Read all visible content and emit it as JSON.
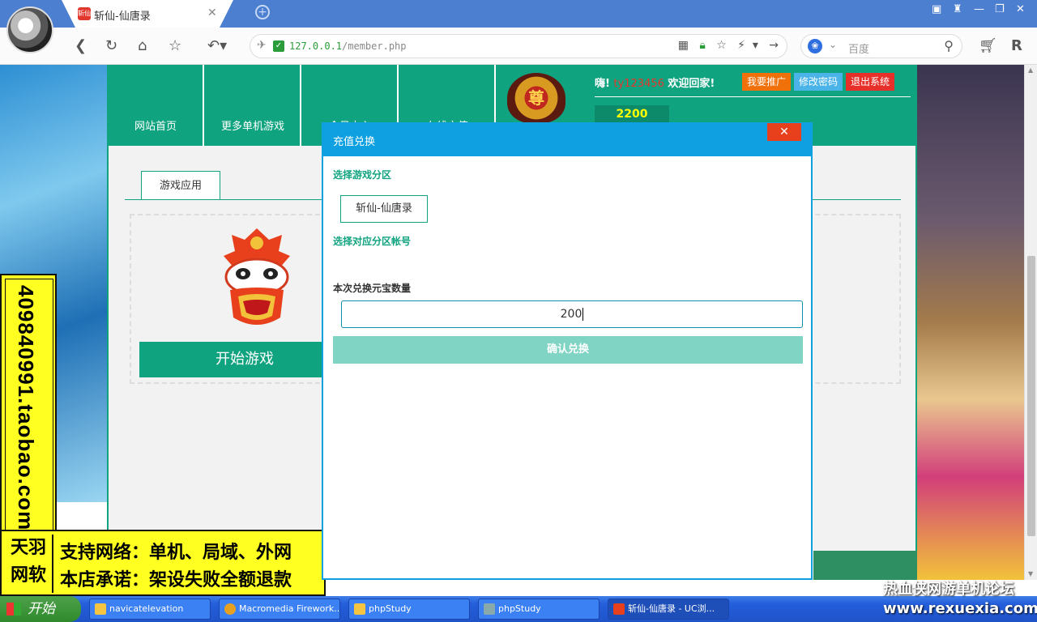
{
  "browser": {
    "tab_title": "斩仙-仙唐录",
    "tab_favicon_text": "斩仙",
    "url_host": "127.0.0.1",
    "url_path": "/member.php",
    "search_placeholder": "百度"
  },
  "site": {
    "nav_items": [
      "网站首页",
      "更多单机游戏",
      "会员中心",
      "在线充值"
    ],
    "crown_char": "尊",
    "greet_prefix": "嗨!",
    "username": "ty123456",
    "greet_suffix": "欢迎回家!",
    "buttons": {
      "promote": "我要推广",
      "change_password": "修改密码",
      "logout": "退出系统"
    },
    "coins": "2200",
    "subtab": "游戏应用",
    "play_button": "开始游戏"
  },
  "modal": {
    "title": "充值兑换",
    "close": "✕",
    "zone_label": "选择游戏分区",
    "zone_value": "斩仙-仙唐录",
    "account_label": "选择对应分区帐号",
    "amount_label": "本次兑换元宝数量",
    "amount_value": "200",
    "confirm": "确认兑换"
  },
  "ads": {
    "side_text": "409840991.taobao.com",
    "brand": [
      "天羽",
      "网软"
    ],
    "line1": "支持网络：单机、局域、外网",
    "line2": "本店承诺：架设失败全额退款"
  },
  "taskbar": {
    "start": "开始",
    "items": [
      "navicatelevation",
      "Macromedia Firework...",
      "phpStudy",
      "phpStudy",
      "斩仙-仙唐录 - UC浏..."
    ]
  },
  "watermark": {
    "line1": "热血侠网游单机论坛",
    "line2": "www.rexuexia.com"
  },
  "colors": {
    "brand_green": "#10a37f",
    "modal_blue": "#0ea0e0",
    "tab_bar": "#4d7fd1"
  }
}
